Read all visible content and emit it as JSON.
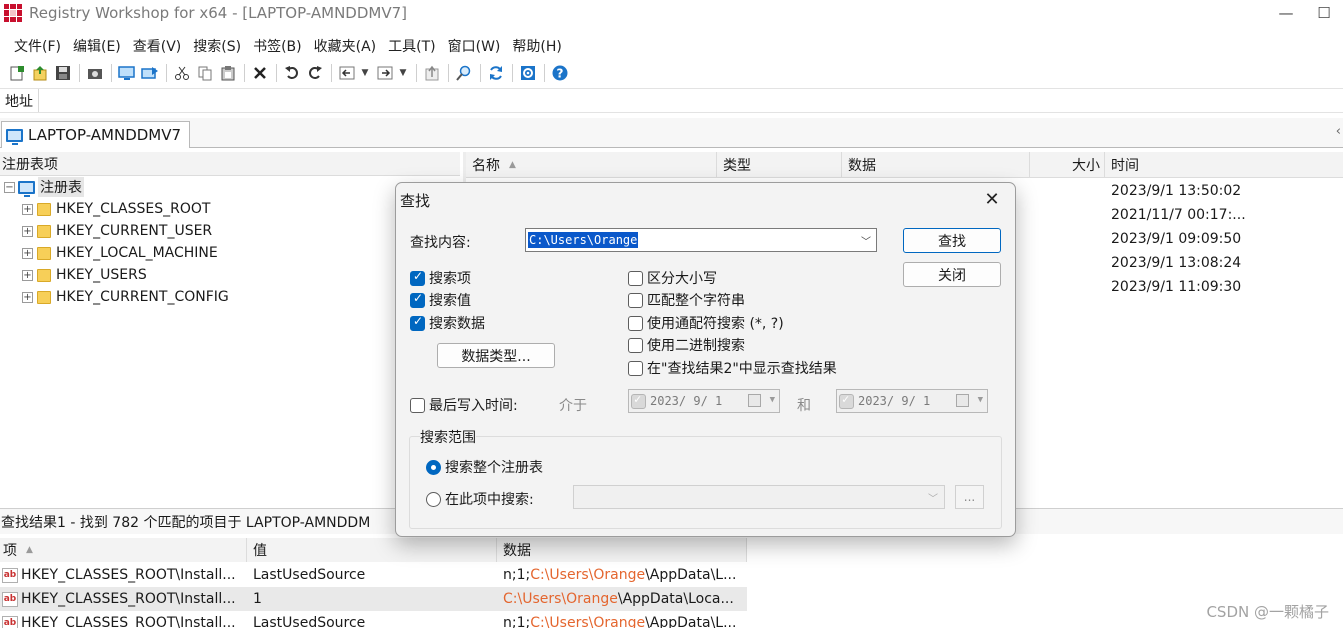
{
  "window": {
    "title": "Registry Workshop for x64 - [LAPTOP-AMNDDMV7]",
    "controls": [
      "—",
      "☐"
    ]
  },
  "menu": [
    "文件(F)",
    "编辑(E)",
    "查看(V)",
    "搜索(S)",
    "书签(B)",
    "收藏夹(A)",
    "工具(T)",
    "窗口(W)",
    "帮助(H)"
  ],
  "toolbar_icons": [
    "new-key-icon",
    "import-icon",
    "save-icon",
    "snapshot-icon",
    "connect-icon",
    "disconnect-icon",
    "cut-icon",
    "copy-icon",
    "paste-icon",
    "delete-icon",
    "undo-icon",
    "redo-icon",
    "back-icon",
    "forward-icon",
    "up-icon",
    "find-icon",
    "refresh-icon",
    "settings-icon",
    "help-icon"
  ],
  "address": {
    "label": "地址",
    "value": ""
  },
  "tab": {
    "label": "LAPTOP-AMNDDMV7"
  },
  "tree": {
    "header": "注册表项",
    "root": "注册表",
    "hives": [
      "HKEY_CLASSES_ROOT",
      "HKEY_CURRENT_USER",
      "HKEY_LOCAL_MACHINE",
      "HKEY_USERS",
      "HKEY_CURRENT_CONFIG"
    ]
  },
  "list": {
    "columns": {
      "name": "名称",
      "type": "类型",
      "data": "数据",
      "size": "大小",
      "time": "时间"
    },
    "times": [
      "2023/9/1 13:50:02",
      "2021/11/7 00:17:...",
      "2023/9/1 09:09:50",
      "2023/9/1 13:08:24",
      "2023/9/1 11:09:30"
    ]
  },
  "results": {
    "status": "查找结果1 - 找到 782 个匹配的项目于 LAPTOP-AMNDDM",
    "columns": {
      "item": "项",
      "value": "值",
      "data": "数据"
    },
    "rows": [
      {
        "item": "HKEY_CLASSES_ROOT\\Install...",
        "value": "LastUsedSource",
        "data_pre": "n;1;",
        "data_hl": "C:\\Users\\Orange",
        "data_post": "\\AppData\\L..."
      },
      {
        "item": "HKEY_CLASSES_ROOT\\Install...",
        "value": "1",
        "data_pre": "",
        "data_hl": "C:\\Users\\Orange",
        "data_post": "\\AppData\\Loca..."
      },
      {
        "item": "HKEY_CLASSES_ROOT\\Install...",
        "value": "LastUsedSource",
        "data_pre": "n;1;",
        "data_hl": "C:\\Users\\Orange",
        "data_post": "\\AppData\\L..."
      }
    ]
  },
  "watermark": "CSDN @一颗橘子",
  "dialog": {
    "title": "查找",
    "close": "✕",
    "find_label": "查找内容:",
    "find_value": "C:\\Users\\Orange",
    "find_button": "查找",
    "close_button": "关闭",
    "options_left": [
      {
        "label": "搜索项",
        "checked": true
      },
      {
        "label": "搜索值",
        "checked": true
      },
      {
        "label": "搜索数据",
        "checked": true
      }
    ],
    "data_type_button": "数据类型...",
    "options_right": [
      {
        "label": "区分大小写",
        "checked": false
      },
      {
        "label": "匹配整个字符串",
        "checked": false
      },
      {
        "label": "使用通配符搜索 (*, ?)",
        "checked": false
      },
      {
        "label": "使用二进制搜索",
        "checked": false
      },
      {
        "label": "在\"查找结果2\"中显示查找结果",
        "checked": false
      }
    ],
    "last_write_label": "最后写入时间:",
    "between_label": "介于",
    "date_from": "2023/ 9/ 1",
    "and_label": "和",
    "date_to": "2023/ 9/ 1",
    "scope": {
      "title": "搜索范围",
      "whole": "搜索整个注册表",
      "in_key": "在此项中搜索:",
      "browse": "..."
    }
  }
}
